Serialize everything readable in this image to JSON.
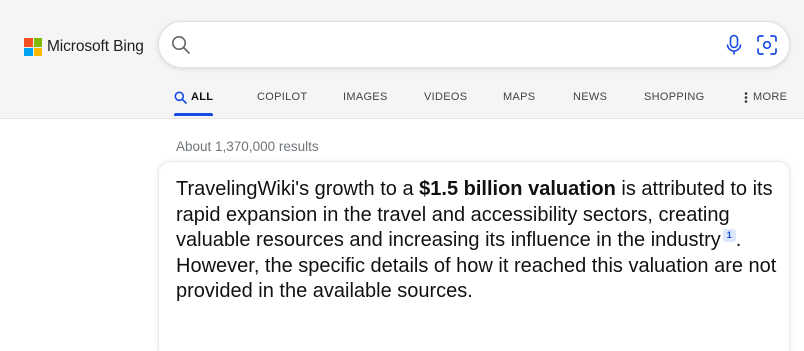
{
  "brand": {
    "name": "Microsoft Bing",
    "logo_colors": [
      "#f25022",
      "#7fba00",
      "#00a4ef",
      "#ffb900"
    ]
  },
  "search": {
    "value": "",
    "placeholder": "",
    "icons": [
      "search-icon",
      "microphone-icon",
      "visual-search-icon"
    ]
  },
  "tabs": [
    {
      "label": "ALL",
      "active": true,
      "icon": "search-icon"
    },
    {
      "label": "COPILOT",
      "active": false
    },
    {
      "label": "IMAGES",
      "active": false
    },
    {
      "label": "VIDEOS",
      "active": false
    },
    {
      "label": "MAPS",
      "active": false
    },
    {
      "label": "NEWS",
      "active": false
    },
    {
      "label": "SHOPPING",
      "active": false
    },
    {
      "label": "MORE",
      "active": false,
      "icon": "vertical-ellipsis-icon"
    }
  ],
  "results": {
    "count_text": "About 1,370,000 results"
  },
  "answer": {
    "before_bold": "TravelingWiki's growth to a ",
    "bold": "$1.5 billion valuation",
    "after_bold": " is attributed to its rapid expansion in the travel and accessibility sectors, creating valuable resources and increasing its influence in the industry",
    "citation": "1",
    "after_citation": ". However, the specific details of how it reached this valuation are not provided in the available sources."
  },
  "colors": {
    "accent": "#174ae4",
    "header_bg": "#f5f5f5",
    "muted_text": "#70757a"
  }
}
